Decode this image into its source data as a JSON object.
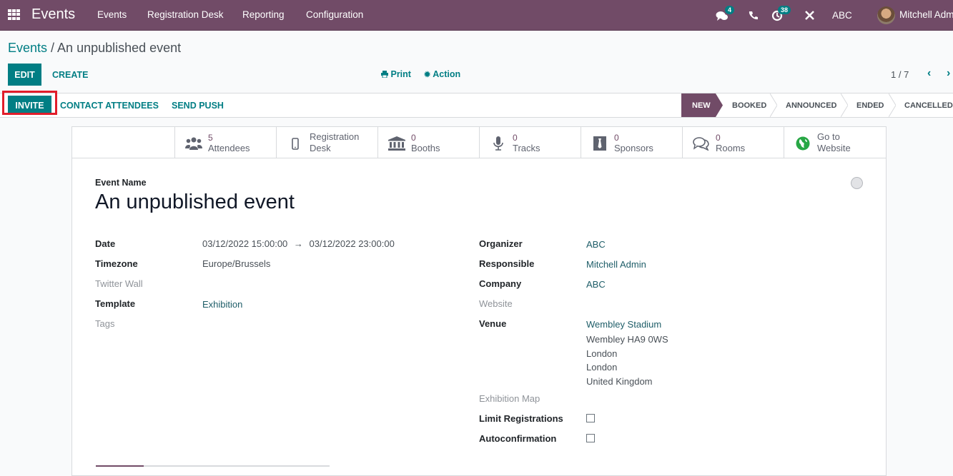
{
  "navbar": {
    "app_name": "Events",
    "menu": [
      "Events",
      "Registration Desk",
      "Reporting",
      "Configuration"
    ],
    "messages_count": "4",
    "activities_count": "38",
    "company": "ABC",
    "user": "Mitchell Adm"
  },
  "breadcrumb": {
    "parent": "Events",
    "separator": " / ",
    "current": "An unpublished event"
  },
  "control_panel": {
    "edit_label": "EDIT",
    "create_label": "CREATE",
    "print_label": "Print",
    "action_label": "Action",
    "pager": "1 / 7"
  },
  "header_buttons": {
    "invite": "INVITE",
    "contact_attendees": "CONTACT ATTENDEES",
    "send_push": "SEND PUSH"
  },
  "stages": [
    "NEW",
    "BOOKED",
    "ANNOUNCED",
    "ENDED",
    "CANCELLED"
  ],
  "active_stage": "NEW",
  "smart_buttons": [
    {
      "value": "5",
      "label": "Attendees",
      "icon": "users-icon"
    },
    {
      "value": "",
      "label": "Registration",
      "label2": "Desk",
      "icon": "mobile-icon"
    },
    {
      "value": "0",
      "label": "Booths",
      "icon": "bank-icon"
    },
    {
      "value": "0",
      "label": "Tracks",
      "icon": "microphone-icon"
    },
    {
      "value": "0",
      "label": "Sponsors",
      "icon": "tie-icon"
    },
    {
      "value": "0",
      "label": "Rooms",
      "icon": "comments-icon"
    },
    {
      "value": "",
      "label": "Go to",
      "label2": "Website",
      "icon": "globe-icon"
    }
  ],
  "form": {
    "event_name_label": "Event Name",
    "event_name": "An unpublished event",
    "left": {
      "date_label": "Date",
      "date_start": "03/12/2022 15:00:00",
      "date_arrow": "→",
      "date_end": "03/12/2022 23:00:00",
      "timezone_label": "Timezone",
      "timezone": "Europe/Brussels",
      "twitter_wall_label": "Twitter Wall",
      "template_label": "Template",
      "template": "Exhibition",
      "tags_label": "Tags"
    },
    "right": {
      "organizer_label": "Organizer",
      "organizer": "ABC",
      "responsible_label": "Responsible",
      "responsible": "Mitchell Admin",
      "company_label": "Company",
      "company": "ABC",
      "website_label": "Website",
      "venue_label": "Venue",
      "venue_name": "Wembley Stadium",
      "venue_lines": [
        "Wembley HA9 0WS",
        "London",
        "London",
        "United Kingdom"
      ],
      "exhibition_map_label": "Exhibition Map",
      "limit_registrations_label": "Limit Registrations",
      "limit_registrations": false,
      "autoconfirmation_label": "Autoconfirmation",
      "autoconfirmation": false
    }
  },
  "colors": {
    "brand": "#714b67",
    "accent": "#017e84",
    "highlight": "#e11d2a"
  }
}
